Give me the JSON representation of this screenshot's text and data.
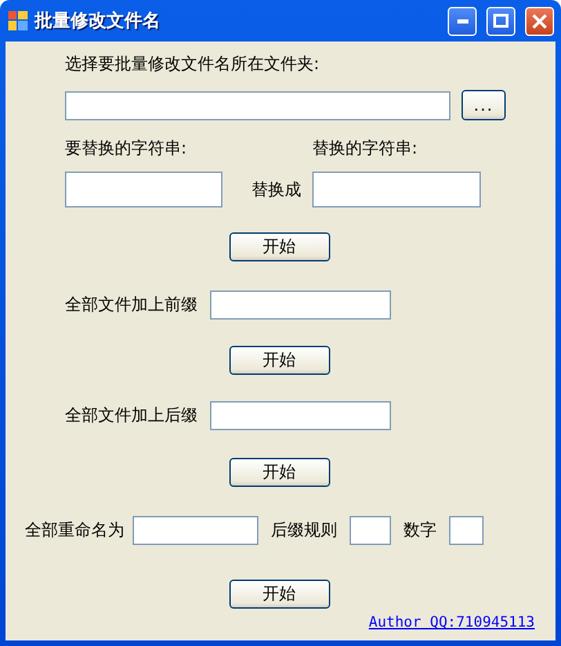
{
  "window": {
    "title": "批量修改文件名"
  },
  "folder": {
    "label": "选择要批量修改文件名所在文件夹:",
    "browse_button": "..."
  },
  "replace": {
    "from_label": "要替换的字符串:",
    "to_label": "替换的字符串:",
    "between_label": "替换成",
    "button": "开始"
  },
  "prefix": {
    "label": "全部文件加上前缀",
    "button": "开始"
  },
  "suffix": {
    "label": "全部文件加上后缀",
    "button": "开始"
  },
  "rename": {
    "label": "全部重命名为",
    "suffix_rule_label": "后缀规则",
    "number_label": "数字",
    "button": "开始"
  },
  "author_link": "Author QQ:710945113"
}
